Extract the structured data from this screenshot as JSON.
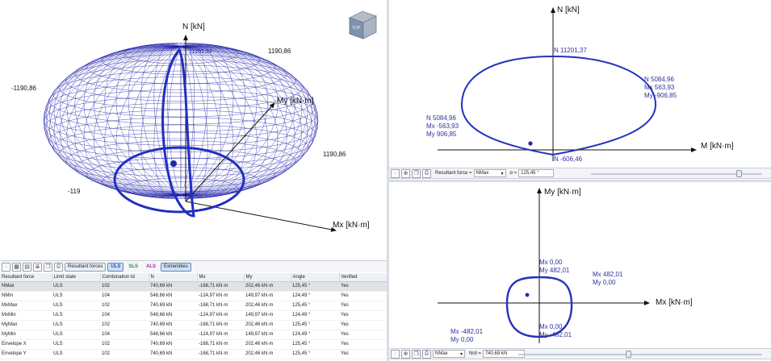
{
  "view3d": {
    "axis_n": "N [kN]",
    "axis_my": "My [kN·m]",
    "axis_mx": "Mx [kN·m]",
    "val_top_right": "1190,86",
    "val_left": "-1190,86",
    "val_right": "1190,86",
    "val_left_low": "-119",
    "top_value": "11201,37",
    "cube_label": "TOP"
  },
  "nm_diagram": {
    "axis_n": "N [kN]",
    "axis_m": "M [kN·m]",
    "top_label": "N 11201,37",
    "bottom_label": "N -606,46",
    "right_label": [
      "N 5084,96",
      "Mx 563,93",
      "My -906,85"
    ],
    "left_label": [
      "N 5084,96",
      "Mx -563,93",
      "My 906,85"
    ],
    "toolbar": {
      "resultant_label": "Resultant force =",
      "resultant_value": "NMax",
      "alpha_label": "α =",
      "alpha_value": "125,45 °",
      "slider_level": 0.88
    }
  },
  "mm_diagram": {
    "axis_my": "My [kN·m]",
    "axis_mx": "Mx [kN·m]",
    "top_label": [
      "Mx 0,00",
      "My 482,01"
    ],
    "right_label": [
      "Mx 482,01",
      "My 0,00"
    ],
    "left_label": [
      "Mx -482,01",
      "My 0,00"
    ],
    "bottom_label": [
      "Mx 0,00",
      "My -482,01"
    ],
    "toolbar": {
      "resultant_value": "NMax",
      "nrd_label": "Nrd =",
      "nrd_value": "740,69 kN",
      "slider_level": 0.45
    }
  },
  "results_toolbar": {
    "resultant_forces": "Resultant forces",
    "uls": "ULS",
    "sls": "SLS",
    "als": "ALS",
    "extremities": "Extremities"
  },
  "table": {
    "headers": [
      "Resultant force",
      "Limit state",
      "Combination Id",
      "N",
      "Mx",
      "My",
      "Angle",
      "Verified"
    ],
    "rows": [
      [
        "NMax",
        "ULS",
        "102",
        "740,69 kN",
        "-168,71 kN·m",
        "202,46 kN·m",
        "125,45 °",
        "Yes"
      ],
      [
        "NMin",
        "ULS",
        "104",
        "548,66 kN",
        "-124,97 kN·m",
        "149,97 kN·m",
        "124,49 °",
        "Yes"
      ],
      [
        "MxMax",
        "ULS",
        "102",
        "740,69 kN",
        "-168,71 kN·m",
        "202,46 kN·m",
        "125,45 °",
        "Yes"
      ],
      [
        "MxMin",
        "ULS",
        "104",
        "548,66 kN",
        "-124,97 kN·m",
        "149,97 kN·m",
        "124,49 °",
        "Yes"
      ],
      [
        "MyMax",
        "ULS",
        "102",
        "740,69 kN",
        "-168,71 kN·m",
        "202,46 kN·m",
        "125,45 °",
        "Yes"
      ],
      [
        "MyMin",
        "ULS",
        "104",
        "548,66 kN",
        "-124,97 kN·m",
        "149,97 kN·m",
        "124,49 °",
        "Yes"
      ],
      [
        "Envelope X",
        "ULS",
        "102",
        "740,69 kN",
        "-168,71 kN·m",
        "202,46 kN·m",
        "125,45 °",
        "Yes"
      ],
      [
        "Envelope Y",
        "ULS",
        "102",
        "740,69 kN",
        "-168,71 kN·m",
        "202,46 kN·m",
        "125,45 °",
        "Yes"
      ]
    ]
  },
  "colors": {
    "diagram": "#1f2fc0",
    "wire": "#1a1aa8",
    "axis": "#111111"
  }
}
